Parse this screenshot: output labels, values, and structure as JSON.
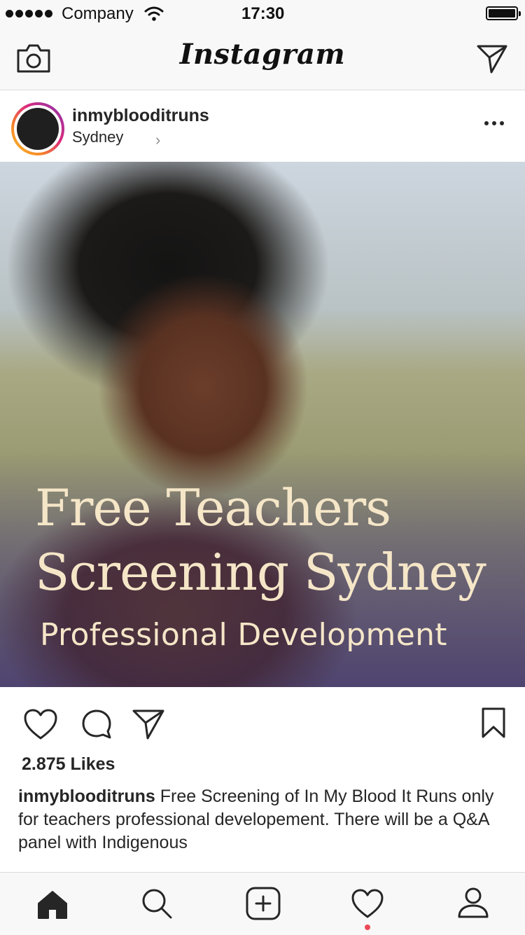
{
  "status_bar": {
    "carrier": "Company",
    "time": "17:30",
    "signal_icon": "signal-dots-icon",
    "wifi_icon": "wifi-icon",
    "battery_icon": "battery-icon"
  },
  "app_header": {
    "logo": "Instagram",
    "camera_icon": "camera-icon",
    "direct_icon": "paper-plane-icon"
  },
  "post": {
    "username": "inmyblooditruns",
    "location": "Sydney",
    "location_chevron": "›",
    "more_icon": "more-options-icon",
    "image": {
      "headline_line1": "Free Teachers",
      "headline_line2": "Screening Sydney",
      "subheading": "Professional Development"
    },
    "likes": "2.875 Likes",
    "caption_user": "inmyblooditruns",
    "caption_text": "Free Screening of In My Blood It Runs only for teachers professional developement. There will be a Q&A panel with Indigenous"
  },
  "post_actions": [
    "heart-icon",
    "comment-icon",
    "share-icon",
    "bookmark-icon"
  ],
  "tab_bar": [
    "home-icon",
    "search-icon",
    "add-post-icon",
    "activity-heart-icon",
    "profile-icon"
  ],
  "colors": {
    "notification_dot": "#ed4956",
    "overlay_text": "#f5e6c8"
  }
}
